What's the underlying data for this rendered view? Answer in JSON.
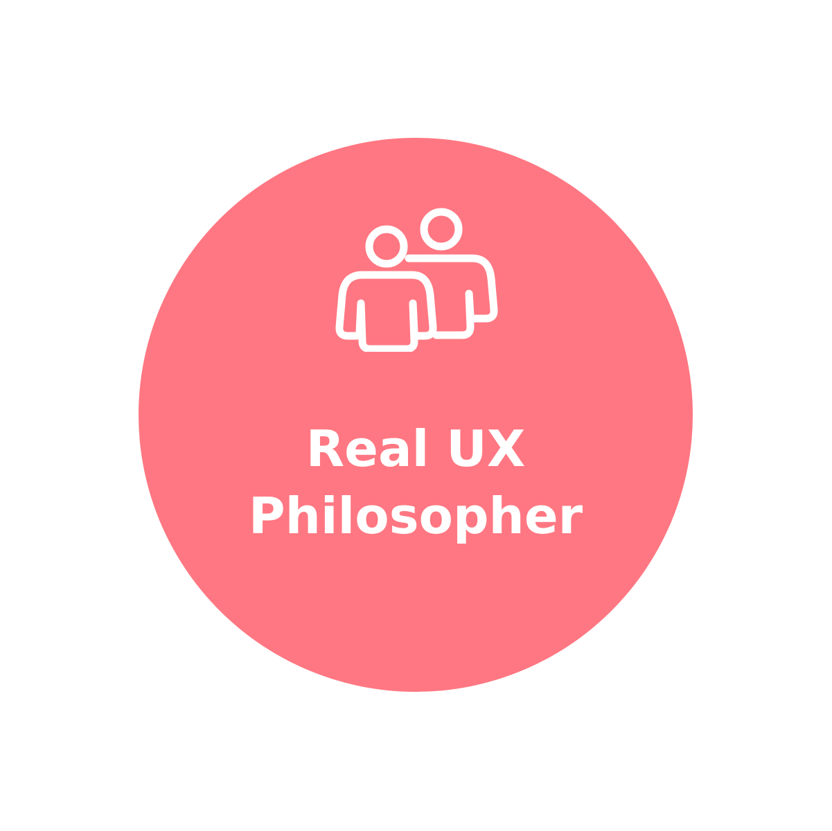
{
  "badge": {
    "color": "#ff7782",
    "icon": "users-icon",
    "title_line1": "Real UX",
    "title_line2": "Philosopher"
  }
}
